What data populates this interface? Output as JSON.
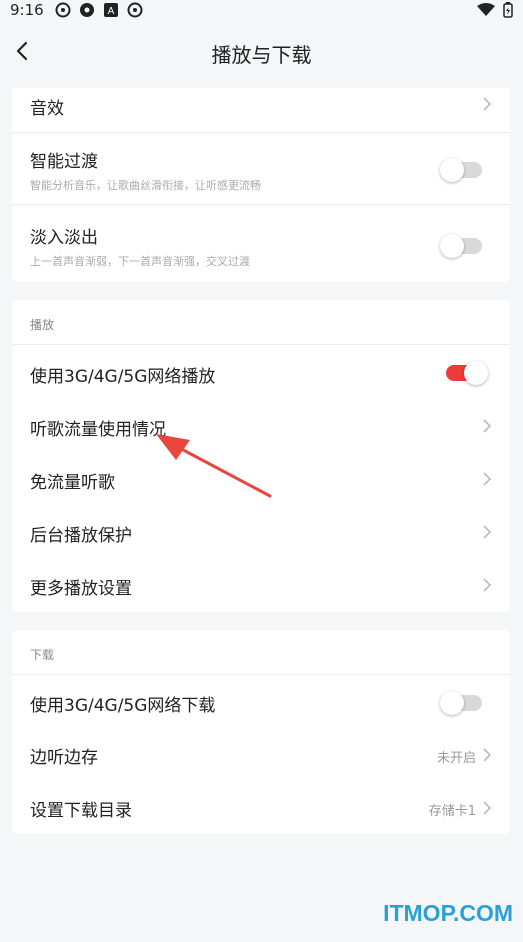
{
  "status_bar": {
    "time": "9:16"
  },
  "header": {
    "title": "播放与下载"
  },
  "sound_card": {
    "items": [
      {
        "title": "音效"
      },
      {
        "title": "智能过渡",
        "subtitle": "智能分析音乐，让歌曲丝滑衔接，让听感更流畅",
        "toggle": "off"
      },
      {
        "title": "淡入淡出",
        "subtitle": "上一首声音渐弱，下一首声音渐强，交叉过渡",
        "toggle": "off"
      }
    ]
  },
  "play_section": {
    "label": "播放",
    "items": [
      {
        "title": "使用3G/4G/5G网络播放",
        "toggle": "on"
      },
      {
        "title": "听歌流量使用情况"
      },
      {
        "title": "免流量听歌"
      },
      {
        "title": "后台播放保护"
      },
      {
        "title": "更多播放设置"
      }
    ]
  },
  "download_section": {
    "label": "下载",
    "items": [
      {
        "title": "使用3G/4G/5G网络下载",
        "toggle": "off"
      },
      {
        "title": "边听边存",
        "value": "未开启"
      },
      {
        "title": "设置下载目录",
        "value": "存储卡1"
      }
    ]
  },
  "watermark": "ITMOP.COM",
  "colors": {
    "accent_toggle": "#ee3a3a",
    "annotation_arrow": "#e8453c",
    "watermark": "#2aa1d6"
  },
  "icons": [
    "back-arrow-icon",
    "chevron-right-icon",
    "wifi-icon",
    "battery-icon",
    "arrow-annotation"
  ]
}
